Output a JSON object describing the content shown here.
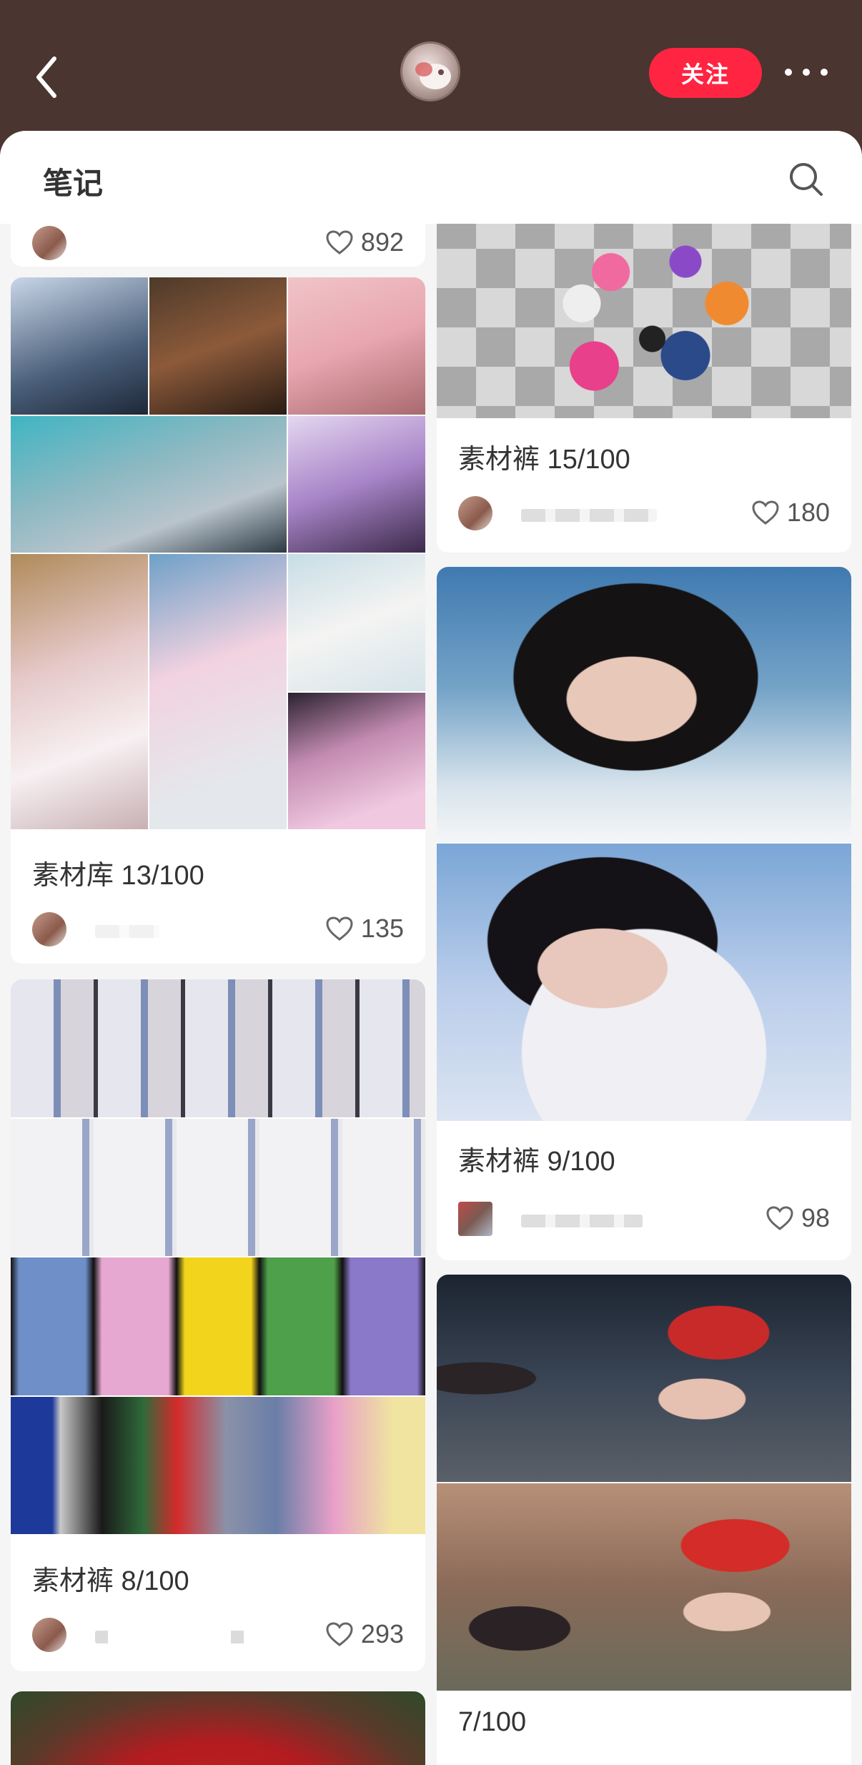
{
  "header": {
    "follow_label": "关注"
  },
  "sheet": {
    "title": "笔记"
  },
  "notes": [
    {
      "title": "",
      "likes": "892"
    },
    {
      "title": "素材裤 15/100",
      "likes": "180"
    },
    {
      "title": "素材库 13/100",
      "likes": "135"
    },
    {
      "title": "素材裤 9/100",
      "likes": "98"
    },
    {
      "title": "素材裤 8/100",
      "likes": "293"
    },
    {
      "title": "7/100",
      "likes": ""
    }
  ],
  "colors": {
    "accent": "#ff2442",
    "header_bg": "#4a3530"
  }
}
